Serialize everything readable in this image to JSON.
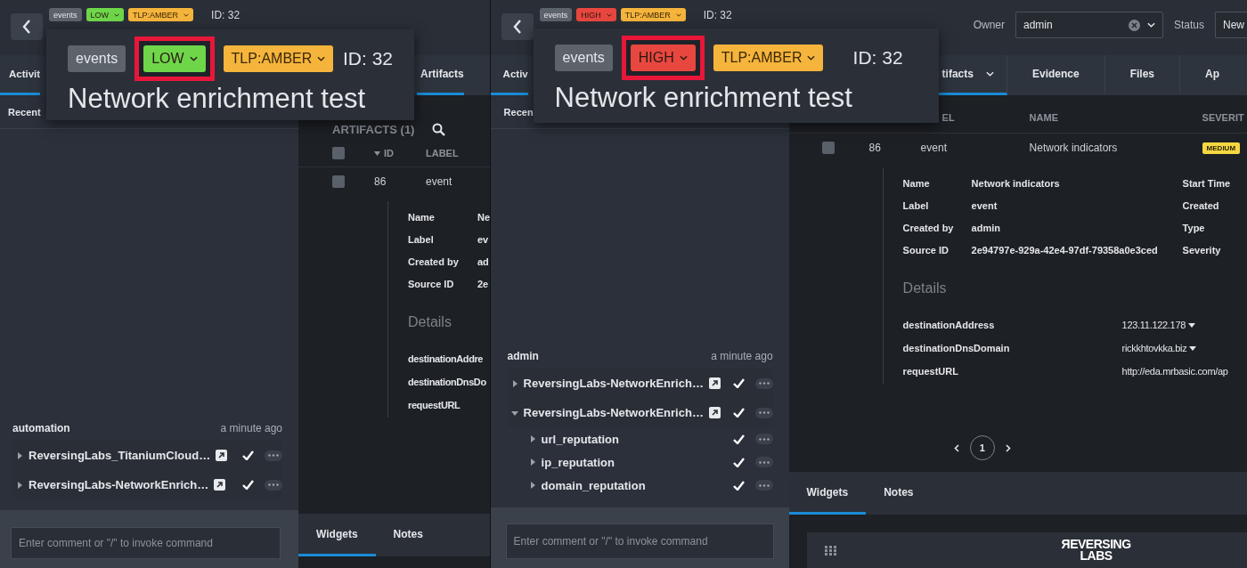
{
  "panels": [
    {
      "header": {
        "tags": [
          {
            "label": "events",
            "kind": "type",
            "color": "#5d636b",
            "dropdown": false
          },
          {
            "label": "LOW",
            "kind": "severity",
            "color": "#6fd64a",
            "dropdown": true
          },
          {
            "label": "TLP:AMBER",
            "kind": "tlp",
            "color": "#f5b43c",
            "dropdown": true
          }
        ],
        "id": "ID: 32"
      },
      "callout": {
        "tags": [
          {
            "label": "events",
            "kind": "type",
            "color": "#5d636b",
            "dropdown": false,
            "highlighted": false
          },
          {
            "label": "LOW",
            "kind": "severity",
            "color": "#6fd64a",
            "dropdown": true,
            "highlighted": true
          },
          {
            "label": "TLP:AMBER",
            "kind": "tlp",
            "color": "#f5b43c",
            "dropdown": true,
            "highlighted": false
          }
        ],
        "id": "ID: 32",
        "title": "Network enrichment test"
      },
      "sidebar": {
        "tabs": [
          {
            "label": "Activit",
            "selected": true
          }
        ],
        "subheader": "Recent",
        "feed": {
          "author": "automation",
          "time": "a minute ago",
          "items": [
            {
              "name": "ReversingLabs_TitaniumCloud…",
              "expanded": false,
              "linked": true,
              "completed": true
            },
            {
              "name": "ReversingLabs-NetworkEnrich…",
              "expanded": false,
              "linked": true,
              "completed": true
            }
          ]
        },
        "comment": {
          "placeholder": "Enter comment or \"/\" to invoke command"
        }
      },
      "content": {
        "tabs": [
          {
            "label": "Artifacts",
            "selected": true,
            "dropdown": false
          }
        ],
        "title": "ARTIFACTS (1)",
        "select_all": {
          "checked": false
        },
        "columns": [
          {
            "label": "ID",
            "sorted": true
          },
          {
            "label": "LABEL",
            "sorted": false
          }
        ],
        "row": {
          "checked": false,
          "cells": [
            "86",
            "event"
          ]
        },
        "details": {
          "fields": [
            {
              "key": "Name",
              "value": "Ne"
            },
            {
              "key": "Label",
              "value": "ev"
            },
            {
              "key": "Created by",
              "value": "ad"
            },
            {
              "key": "Source ID",
              "value": "2e"
            }
          ],
          "heading": "Details",
          "attributes": [
            {
              "key": "destinationAddre"
            },
            {
              "key": "destinationDnsDo"
            },
            {
              "key": "requestURL"
            }
          ]
        },
        "bottom_tabs": [
          {
            "label": "Widgets",
            "selected": true
          },
          {
            "label": "Notes",
            "selected": false
          }
        ]
      }
    },
    {
      "header": {
        "tags": [
          {
            "label": "events",
            "kind": "type",
            "color": "#5d636b",
            "dropdown": false
          },
          {
            "label": "HIGH",
            "kind": "severity",
            "color": "#e8473f",
            "dropdown": true
          },
          {
            "label": "TLP:AMBER",
            "kind": "tlp",
            "color": "#f5b43c",
            "dropdown": true
          }
        ],
        "id": "ID: 32",
        "owner": {
          "label": "Owner",
          "value": "admin"
        },
        "status": {
          "label": "Status",
          "value": "New"
        }
      },
      "callout": {
        "tags": [
          {
            "label": "events",
            "kind": "type",
            "color": "#5d636b",
            "dropdown": false,
            "highlighted": false
          },
          {
            "label": "HIGH",
            "kind": "severity",
            "color": "#e8473f",
            "dropdown": true,
            "highlighted": true
          },
          {
            "label": "TLP:AMBER",
            "kind": "tlp",
            "color": "#f5b43c",
            "dropdown": true,
            "highlighted": false
          }
        ],
        "id": "ID: 32",
        "title": "Network enrichment test"
      },
      "sidebar": {
        "tabs": [
          {
            "label": "Activ",
            "selected": true
          }
        ],
        "subheader": "Recen",
        "feed": {
          "author": "admin",
          "time": "a minute ago",
          "items": [
            {
              "name": "ReversingLabs-NetworkEnrich…",
              "expanded": false,
              "linked": true,
              "completed": true
            },
            {
              "name": "ReversingLabs-NetworkEnrich…",
              "expanded": true,
              "linked": true,
              "completed": true,
              "children": [
                {
                  "name": "url_reputation",
                  "expanded": false,
                  "linked": false,
                  "completed": true
                },
                {
                  "name": "ip_reputation",
                  "expanded": false,
                  "linked": false,
                  "completed": true
                },
                {
                  "name": "domain_reputation",
                  "expanded": false,
                  "linked": false,
                  "completed": true
                }
              ]
            }
          ]
        },
        "comment": {
          "placeholder": "Enter comment or \"/\" to invoke command"
        }
      },
      "content": {
        "tabs": [
          {
            "label": "tifacts",
            "selected": true,
            "dropdown": true
          },
          {
            "label": "Evidence",
            "selected": false,
            "dropdown": false
          },
          {
            "label": "Files",
            "selected": false,
            "dropdown": false
          },
          {
            "label": "Ap",
            "selected": false,
            "dropdown": false
          }
        ],
        "columns": [
          {
            "label": "EL",
            "sorted": false
          },
          {
            "label": "NAME",
            "sorted": false
          },
          {
            "label": "SEVERIT",
            "sorted": false
          }
        ],
        "row": {
          "checked": false,
          "cells": [
            "86",
            "event",
            "Network indicators"
          ],
          "badge": "MEDIUM"
        },
        "details": {
          "fields": [
            {
              "key": "Name",
              "value": "Network indicators",
              "side": "Start Time"
            },
            {
              "key": "Label",
              "value": "event",
              "side": "Created"
            },
            {
              "key": "Created by",
              "value": "admin",
              "side": "Type"
            },
            {
              "key": "Source ID",
              "value": "2e94797e-929a-42e4-97df-79358a0e3ced",
              "side": "Severity"
            }
          ],
          "heading": "Details",
          "attributes": [
            {
              "key": "destinationAddress",
              "value": "123.11.122.178",
              "dropdown": true
            },
            {
              "key": "destinationDnsDomain",
              "value": "rickkhtovkka.biz",
              "dropdown": true
            },
            {
              "key": "requestURL",
              "value": "http://eda.mrbasic.com/ap",
              "dropdown": false
            }
          ]
        },
        "pagination": {
          "pages": [
            {
              "label": "1",
              "selected": true
            }
          ]
        },
        "bottom_tabs": [
          {
            "label": "Widgets",
            "selected": true
          },
          {
            "label": "Notes",
            "selected": false
          }
        ],
        "widget": {
          "logo_lines": [
            "ЯEVERSING",
            "LABS"
          ]
        }
      }
    }
  ]
}
